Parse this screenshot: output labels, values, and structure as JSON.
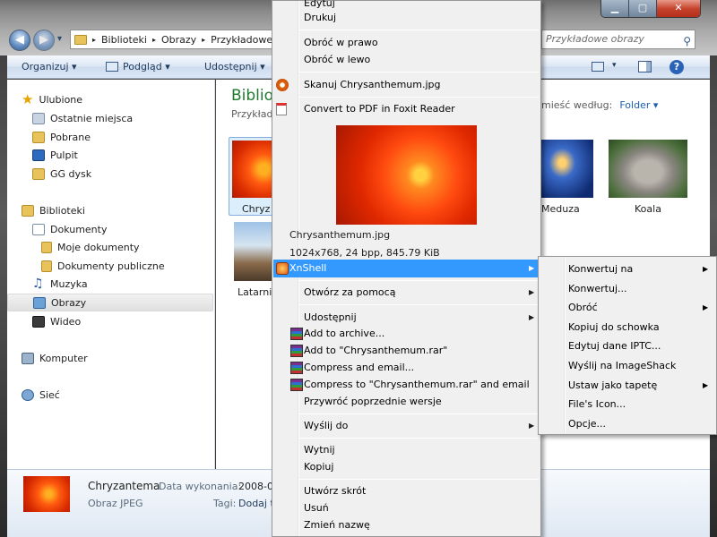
{
  "window": {
    "caption": {
      "minimize": "▁",
      "maximize": "▢",
      "close": "✕"
    },
    "nav": {
      "back": "◀",
      "forward": "▶",
      "down": "▾"
    }
  },
  "address": {
    "sep": "▸",
    "crumbs": [
      "Biblioteki",
      "Obrazy",
      "Przykładowe"
    ]
  },
  "search": {
    "placeholder": "Przykładowe obrazy"
  },
  "toolbar": {
    "organize": "Organizuj ▾",
    "preview": "Podgląd ▾",
    "share": "Udostępnij ▾"
  },
  "sidebar": {
    "favorites": "Ulubione",
    "recent": "Ostatnie miejsca",
    "downloads": "Pobrane",
    "desktop": "Pulpit",
    "gg": "GG dysk",
    "libraries": "Biblioteki",
    "documents": "Dokumenty",
    "my_docs": "Moje dokumenty",
    "public_docs": "Dokumenty publiczne",
    "music": "Muzyka",
    "pictures": "Obrazy",
    "videos": "Wideo",
    "computer": "Komputer",
    "network": "Sieć"
  },
  "content": {
    "title": "Biblio",
    "subtitle": "Przykład",
    "arrange_label": "mieść według:",
    "arrange_value": "Folder ▾",
    "items": [
      "Chryz",
      "Meduza",
      "Koala",
      "Latarni"
    ]
  },
  "details": {
    "name": "Chryzantema",
    "type": "Obraz JPEG",
    "date_label": "Data wykonania:",
    "date_value": "2008-0",
    "tags_label": "Tagi:",
    "tags_value": "Dodaj t"
  },
  "menu": {
    "edit": "Edytuj",
    "print": "Drukuj",
    "rotate_right": "Obróć w prawo",
    "rotate_left": "Obróć w lewo",
    "scan": "Skanuj Chrysanthemum.jpg",
    "foxit": "Convert to PDF in Foxit Reader",
    "preview_name": "Chrysanthemum.jpg",
    "preview_info": "1024x768, 24 bpp, 845.79 KiB",
    "xnshell": "XnShell",
    "open_with": "Otwórz za pomocą",
    "share": "Udostępnij",
    "add_archive": "Add to archive...",
    "add_rar": "Add to \"Chrysanthemum.rar\"",
    "compress_email": "Compress and email...",
    "compress_rar_email": "Compress to \"Chrysanthemum.rar\" and email",
    "restore": "Przywróć poprzednie wersje",
    "send_to": "Wyślij do",
    "cut": "Wytnij",
    "copy": "Kopiuj",
    "shortcut": "Utwórz skrót",
    "delete": "Usuń",
    "rename": "Zmień nazwę"
  },
  "submenu": {
    "convert_to": "Konwertuj na",
    "convert": "Konwertuj...",
    "rotate": "Obróć",
    "copy_clip": "Kopiuj do schowka",
    "edit_iptc": "Edytuj dane IPTC...",
    "imageshack": "Wyślij na ImageShack",
    "wallpaper": "Ustaw jako tapetę",
    "file_icon": "File's Icon...",
    "options": "Opcje..."
  },
  "arrow": "▶",
  "icons": {
    "favorites": "star-icon",
    "recent": "recent-places-icon",
    "downloads": "downloads-folder-icon",
    "desktop": "desktop-icon",
    "libraries": "library-icon",
    "music": "music-note-icon",
    "computer": "computer-icon",
    "network": "network-icon",
    "search": "search-icon"
  },
  "colors": {
    "menu_highlight": "#3399ff",
    "library_title": "#1e7a2f",
    "link_blue": "#1b5eb1"
  }
}
